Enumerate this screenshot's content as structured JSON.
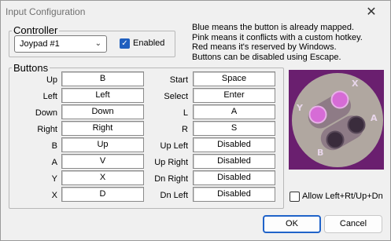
{
  "window": {
    "title": "Input Configuration",
    "close_glyph": "✕"
  },
  "controller": {
    "group_label": "Controller",
    "device": "Joypad #1",
    "enabled_label": "Enabled",
    "enabled": true
  },
  "info_lines": [
    "Blue means the button is already mapped.",
    "Pink means it conflicts with a custom hotkey.",
    "Red means it's reserved by Windows.",
    "Buttons can be disabled using Escape."
  ],
  "buttons": {
    "group_label": "Buttons",
    "left_column": [
      {
        "label": "Up",
        "value": "B"
      },
      {
        "label": "Left",
        "value": "Left"
      },
      {
        "label": "Down",
        "value": "Down"
      },
      {
        "label": "Right",
        "value": "Right"
      },
      {
        "label": "B",
        "value": "Up"
      },
      {
        "label": "A",
        "value": "V"
      },
      {
        "label": "Y",
        "value": "X"
      },
      {
        "label": "X",
        "value": "D"
      }
    ],
    "right_column": [
      {
        "label": "Start",
        "value": "Space"
      },
      {
        "label": "Select",
        "value": "Enter"
      },
      {
        "label": "L",
        "value": "A"
      },
      {
        "label": "R",
        "value": "S"
      },
      {
        "label": "Up Left",
        "value": "Disabled"
      },
      {
        "label": "Up Right",
        "value": "Disabled"
      },
      {
        "label": "Dn Right",
        "value": "Disabled"
      },
      {
        "label": "Dn Left",
        "value": "Disabled"
      }
    ]
  },
  "controller_image": {
    "icon": "snes-face-buttons-icon",
    "labels": {
      "x": "X",
      "y": "Y",
      "a": "A",
      "b": "B"
    },
    "colors": {
      "plate": "#6a1f6f",
      "pad": "#b0a7a0",
      "pink": "#d66cd6",
      "dark": "#3a2c3c",
      "letters": "#e8d6ea"
    }
  },
  "allow_diagonal": {
    "label": "Allow Left+Rt/Up+Dn",
    "checked": false
  },
  "footer": {
    "ok_label": "OK",
    "cancel_label": "Cancel"
  }
}
